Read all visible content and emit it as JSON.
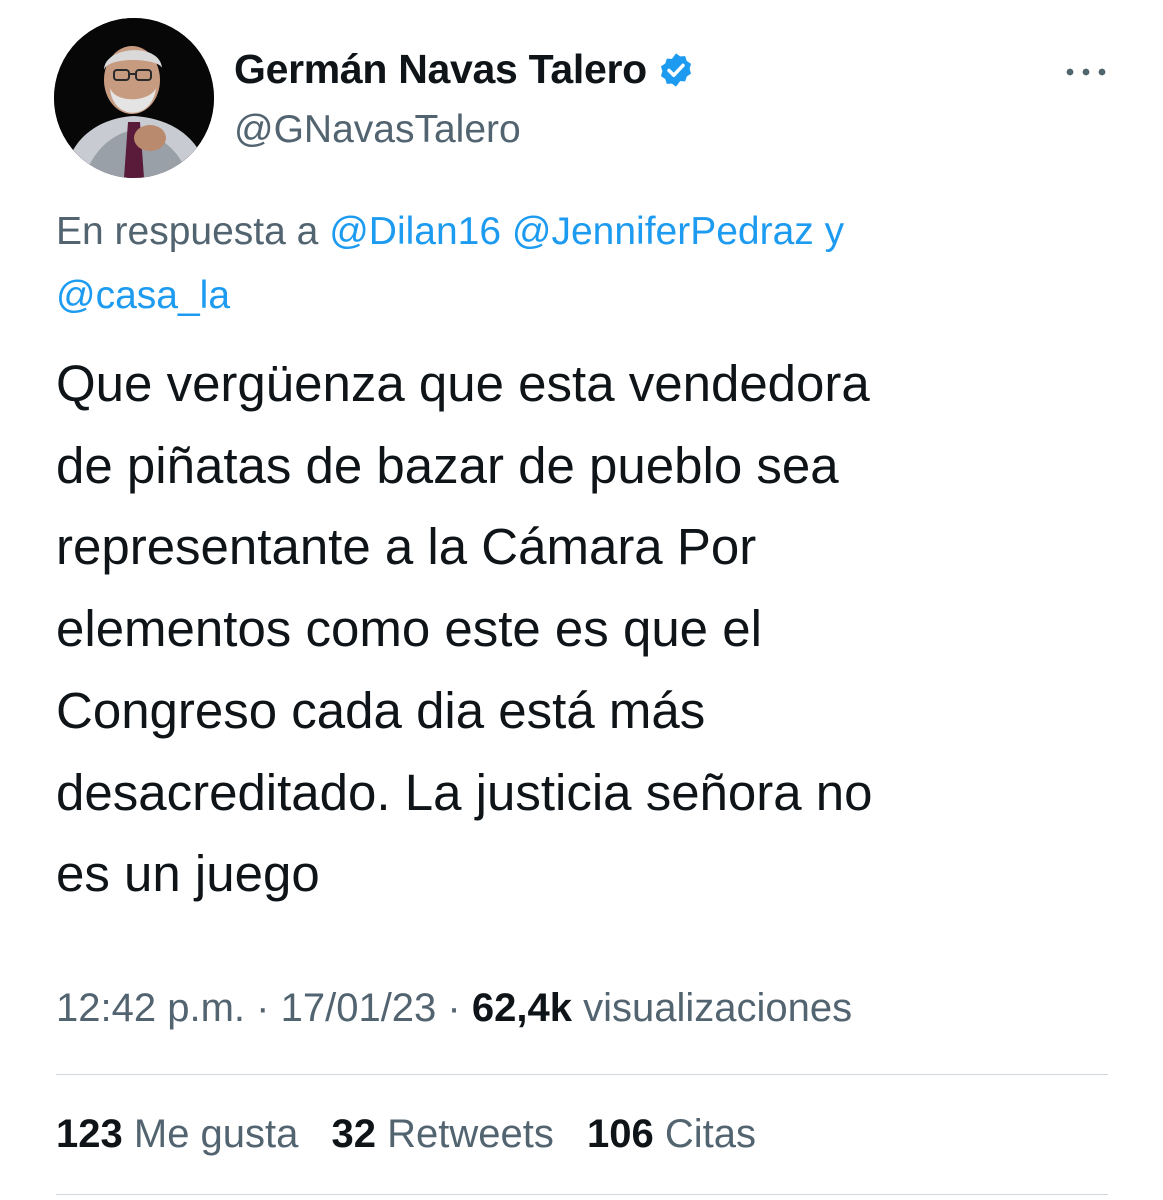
{
  "author": {
    "name": "Germán Navas Talero",
    "handle": "@GNavasTalero",
    "verified": true,
    "verified_color": "#1d9bf0"
  },
  "more_icon": "more-horizontal-icon",
  "reply_context": {
    "prefix": "En respuesta a",
    "mentions": [
      "@Dilan16",
      "@JenniferPedraz",
      "@casa_la"
    ],
    "joiner": "y"
  },
  "tweet": {
    "text_lines": [
      "Que vergüenza que esta vendedora",
      "de piñatas de bazar de pueblo sea",
      "representante a la Cámara  Por",
      "elementos como este es que el",
      "Congreso cada dia está más",
      "desacreditado. La justicia señora no",
      "es un juego"
    ]
  },
  "meta": {
    "time": "12:42 p.m.",
    "separator": "·",
    "date": "17/01/23",
    "views_count": "62,4k",
    "views_label": "visualizaciones"
  },
  "stats": {
    "likes_count": "123",
    "likes_label": "Me gusta",
    "retweets_count": "32",
    "retweets_label": "Retweets",
    "quotes_count": "106",
    "quotes_label": "Citas"
  },
  "colors": {
    "link": "#1d9bf0",
    "secondary_text": "#536471",
    "primary_text": "#0f1419",
    "divider": "#cfd9de"
  }
}
